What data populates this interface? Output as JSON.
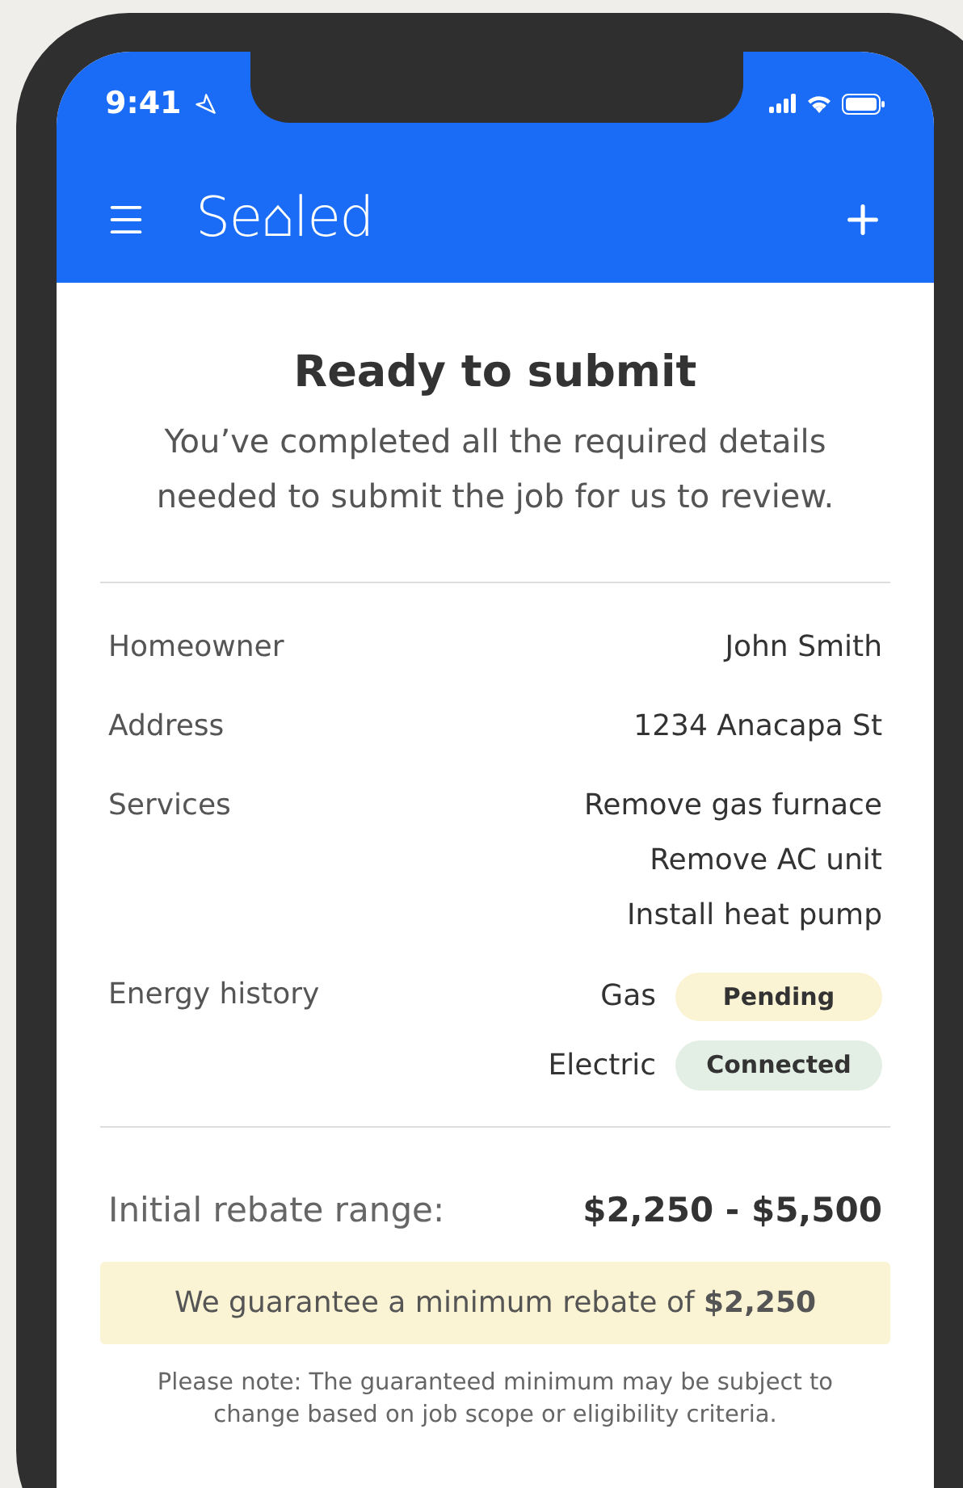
{
  "status_bar": {
    "time": "9:41"
  },
  "header": {
    "logo": "Se⌂led"
  },
  "title": "Ready to submit",
  "subtitle": "You’ve completed all the required details needed to submit the job for us to review.",
  "details": [
    {
      "label": "Homeowner",
      "values": [
        "John Smith"
      ]
    },
    {
      "label": "Address",
      "values": [
        "1234 Anacapa St"
      ]
    },
    {
      "label": "Services",
      "values": [
        "Remove gas furnace",
        "Remove AC unit",
        "Install heat pump"
      ]
    },
    {
      "label": "Energy history",
      "statuses": [
        {
          "name": "Gas",
          "status": "Pending",
          "color": "#faf3d4"
        },
        {
          "name": "Electric",
          "status": "Connected",
          "color": "#e3eee4"
        }
      ]
    }
  ],
  "rebate": {
    "label": "Initial rebate range:",
    "range": "$2,250 - $5,500",
    "guarantee": "We guarantee a minimum rebate of **$2,250**",
    "note": "Please note: The guaranteed minimum may be subject to change based on job scope or eligibility criteria."
  }
}
